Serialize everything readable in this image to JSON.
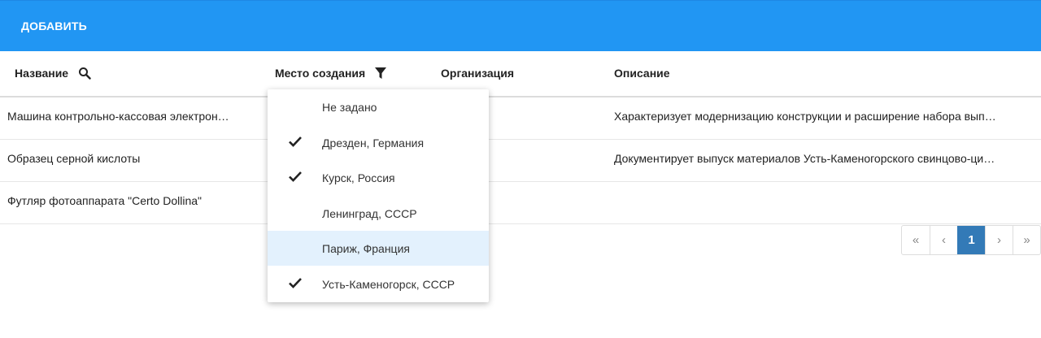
{
  "toolbar": {
    "add_label": "ДОБАВИТЬ"
  },
  "table": {
    "columns": [
      {
        "label": "Название",
        "icon": "search-icon"
      },
      {
        "label": "Место создания",
        "icon": "filter-icon"
      },
      {
        "label": "Организация"
      },
      {
        "label": "Описание"
      }
    ],
    "rows": [
      {
        "name": "Машина контрольно-кассовая электрон…",
        "organization": "",
        "description": "Характеризует модернизацию конструкции и расширение набора вып…"
      },
      {
        "name": "Образец серной кислоты",
        "organization": "",
        "description": "Документирует выпуск материалов Усть-Каменогорского свинцово-ци…"
      },
      {
        "name": "Футляр фотоаппарата \"Certo Dollina\"",
        "organization": "",
        "description": ""
      }
    ]
  },
  "filter_dropdown": {
    "items": [
      {
        "label": "Не задано",
        "checked": false
      },
      {
        "label": "Дрезден, Германия",
        "checked": true
      },
      {
        "label": "Курск, Россия",
        "checked": true
      },
      {
        "label": "Ленинград, СССР",
        "checked": false
      },
      {
        "label": "Париж, Франция",
        "checked": false,
        "highlighted": true
      },
      {
        "label": "Усть-Каменогорск, СССР",
        "checked": true
      }
    ]
  },
  "pagination": {
    "first": "«",
    "prev": "‹",
    "current": "1",
    "next": "›",
    "last": "»"
  },
  "colors": {
    "topbar": "#2196f3",
    "accent": "#337ab7",
    "highlight": "#e3f1fd"
  }
}
